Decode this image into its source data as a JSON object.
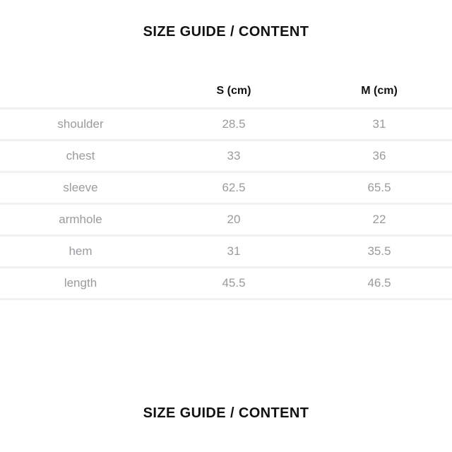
{
  "document": {
    "title_top": "SIZE GUIDE / CONTENT",
    "title_bottom": "SIZE GUIDE / CONTENT",
    "background_color": "#ffffff",
    "title_color": "#111111",
    "cell_text_color": "#9b9b9f",
    "row_divider_color": "#f1f1f2"
  },
  "table": {
    "headers": {
      "measurement": "",
      "columns": [
        "S (cm)",
        "M (cm)"
      ]
    },
    "rows": [
      {
        "label": "shoulder",
        "s": "28.5",
        "m": "31"
      },
      {
        "label": "chest",
        "s": "33",
        "m": "36"
      },
      {
        "label": "sleeve",
        "s": "62.5",
        "m": "65.5"
      },
      {
        "label": "armhole",
        "s": "20",
        "m": "22"
      },
      {
        "label": "hem",
        "s": "31",
        "m": "35.5"
      },
      {
        "label": "length",
        "s": "45.5",
        "m": "46.5"
      }
    ]
  }
}
